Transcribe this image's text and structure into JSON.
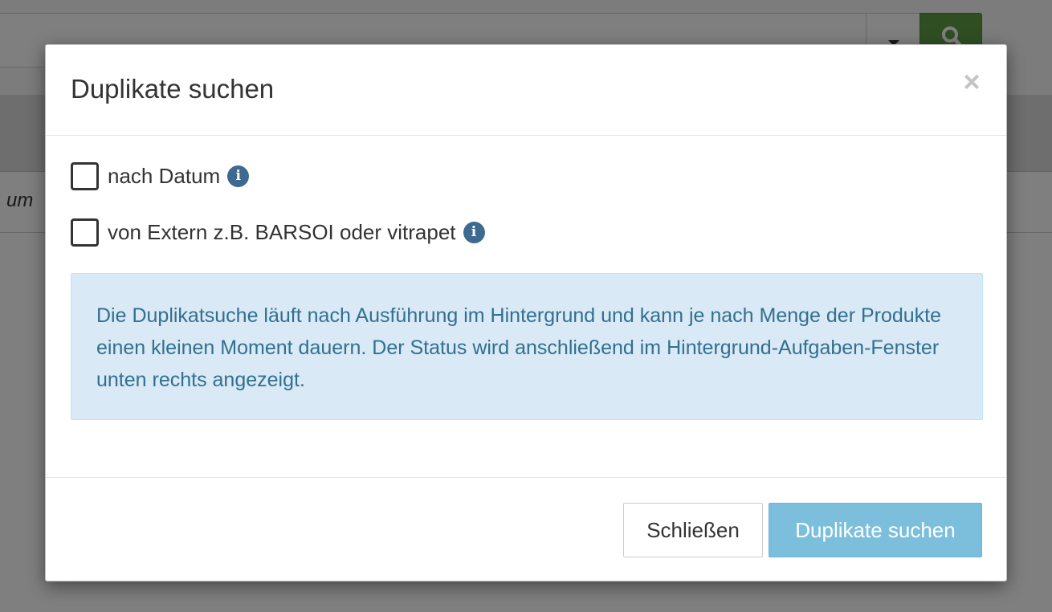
{
  "background": {
    "search": {
      "value": "",
      "dropdown_icon": "caret-down-icon",
      "button_icon": "search-icon",
      "button_color": "#5f9e46"
    },
    "row_text": "um"
  },
  "modal": {
    "title": "Duplikate suchen",
    "close_symbol": "×",
    "options": [
      {
        "label": "nach Datum",
        "checked": false,
        "icon": "info-icon",
        "icon_symbol": "i"
      },
      {
        "label": "von Extern z.B. BARSOI oder vitrapet",
        "checked": false,
        "icon": "info-icon",
        "icon_symbol": "i"
      }
    ],
    "info_text": "Die Duplikatsuche läuft nach Ausführung im Hintergrund und kann je nach Menge der Produkte einen kleinen Moment dauern. Der Status wird anschließend im Hintergrund-Aufgaben-Fenster unten rechts angezeigt.",
    "footer": {
      "close_label": "Schließen",
      "submit_label": "Duplikate suchen"
    }
  },
  "colors": {
    "info_icon": "#3e6a8f",
    "alert_bg": "#d9e9f5",
    "alert_text": "#31708f",
    "primary_button": "#7cbfdc"
  }
}
